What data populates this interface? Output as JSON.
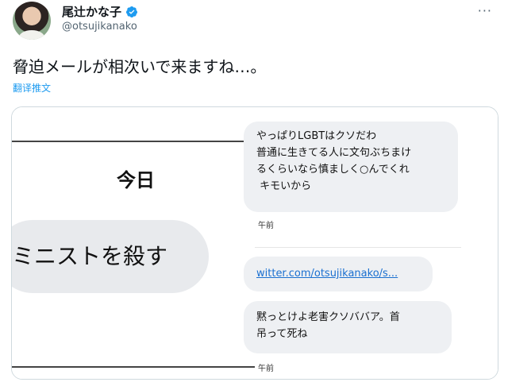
{
  "author": {
    "display_name": "尾辻かな子",
    "handle": "@otsujikanako"
  },
  "menu": {
    "more_label": "···"
  },
  "tweet": {
    "text": "脅迫メールが相次いで来ますね…。",
    "translate_label": "翻译推文"
  },
  "image": {
    "left": {
      "date_header": "今日",
      "message": "ミニストを殺す"
    },
    "right": {
      "messages": [
        {
          "lines": "やっぱりLGBTはクソだわ\n普通に生きてる人に文句ぶちまけ\nるくらいなら慎ましく○んでくれ\n キモいから",
          "time": "午前"
        },
        {
          "lines": "witter.com/otsujikanako/s...",
          "time": ""
        },
        {
          "lines": "黙っとけよ老害クソババア。首\n吊って死ね",
          "time": "午前"
        }
      ]
    }
  },
  "colors": {
    "link_blue": "#1d9bf0",
    "verified_blue": "#1d9bf0"
  }
}
